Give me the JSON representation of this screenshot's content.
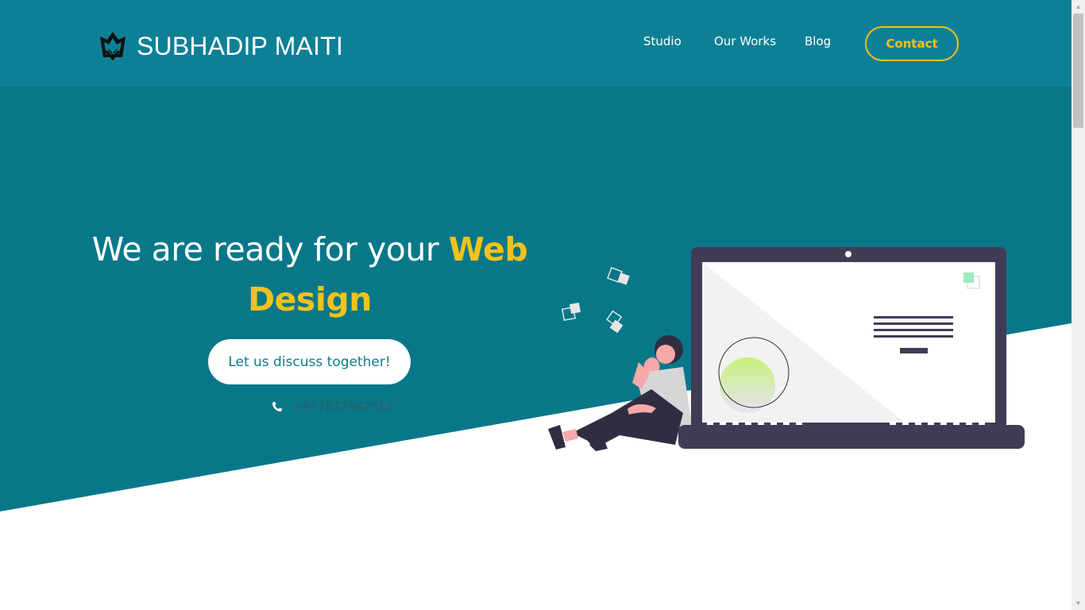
{
  "brand": {
    "name": "SUBHADIP MAITI",
    "logo_icon": "crown-logo-icon"
  },
  "nav": {
    "items": [
      {
        "label": "Studio"
      },
      {
        "label": "Our Works"
      },
      {
        "label": "Blog"
      }
    ],
    "contact_label": "Contact"
  },
  "hero": {
    "headline_part1": "We are ready for your ",
    "headline_accent_1": "Web",
    "headline_accent_2": "Design",
    "cta_label": "Let us discuss together!",
    "phone_icon": "phone-icon",
    "phone": "+917872962510"
  },
  "colors": {
    "teal": "#087889",
    "navbar_teal": "#0e8096",
    "accent_yellow": "#f2c21b",
    "white": "#ffffff",
    "laptop_dark": "#3f3d56"
  },
  "illustration": {
    "name": "person-with-laptop-illustration"
  }
}
